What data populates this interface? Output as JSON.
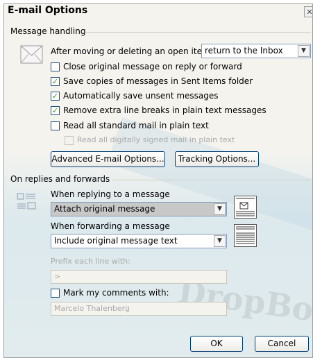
{
  "dialog": {
    "title": "E-mail Options",
    "close_glyph": "✕"
  },
  "message_handling": {
    "group_label": "Message handling",
    "after_move_label": "After moving or deleting an open item:",
    "after_move_value": "return to the Inbox",
    "checkboxes": [
      {
        "label": "Close original message on reply or forward",
        "checked": false
      },
      {
        "label": "Save copies of messages in Sent Items folder",
        "checked": true
      },
      {
        "label": "Automatically save unsent messages",
        "checked": true
      },
      {
        "label": "Remove extra line breaks in plain text messages",
        "checked": true
      },
      {
        "label": "Read all standard mail in plain text",
        "checked": false
      },
      {
        "label": "Read all digitally signed mail in plain text",
        "checked": false,
        "disabled": true
      }
    ],
    "advanced_button": "Advanced E-mail Options...",
    "tracking_button": "Tracking Options..."
  },
  "replies": {
    "group_label": "On replies and forwards",
    "reply_label": "When replying to a message",
    "reply_value": "Attach original message",
    "forward_label": "When forwarding a message",
    "forward_value": "Include original message text",
    "prefix_label": "Prefix each line with:",
    "prefix_value": ">",
    "mark_label": "Mark my comments with:",
    "mark_value": "Marcelo Thalenberg"
  },
  "footer": {
    "ok": "OK",
    "cancel": "Cancel"
  },
  "watermark": "DropBo"
}
